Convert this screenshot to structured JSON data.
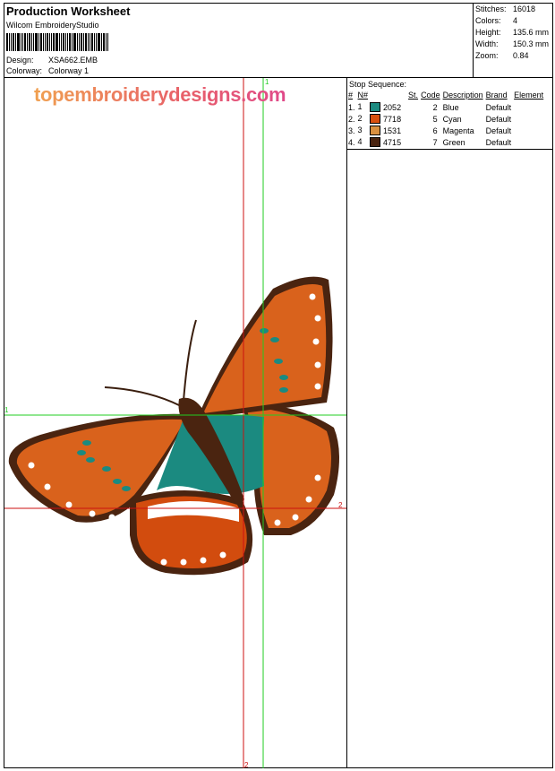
{
  "header": {
    "title": "Production Worksheet",
    "software": "Wilcom EmbroideryStudio",
    "design_label": "Design:",
    "design_value": "XSA662.EMB",
    "colorway_label": "Colorway:",
    "colorway_value": "Colorway 1"
  },
  "stats": [
    {
      "label": "Stitches:",
      "value": "16018"
    },
    {
      "label": "Colors:",
      "value": "4"
    },
    {
      "label": "Height:",
      "value": "135.6 mm"
    },
    {
      "label": "Width:",
      "value": "150.3 mm"
    },
    {
      "label": "Zoom:",
      "value": "0.84"
    }
  ],
  "sequence": {
    "title": "Stop Sequence:",
    "headers": [
      "#",
      "N#",
      "St.",
      "Code",
      "Description",
      "Brand",
      "Element"
    ],
    "rows": [
      {
        "num": "1.",
        "n": "1",
        "color": "#1b8a80",
        "st": "2052",
        "code": "2",
        "desc": "Blue",
        "brand": "Default"
      },
      {
        "num": "2.",
        "n": "2",
        "color": "#d9500f",
        "st": "7718",
        "code": "5",
        "desc": "Cyan",
        "brand": "Default"
      },
      {
        "num": "3.",
        "n": "3",
        "color": "#d99040",
        "st": "1531",
        "code": "6",
        "desc": "Magenta",
        "brand": "Default"
      },
      {
        "num": "4.",
        "n": "4",
        "color": "#4a2410",
        "st": "4715",
        "code": "7",
        "desc": "Green",
        "brand": "Default"
      }
    ]
  },
  "watermark": "topembroiderydesigns.com",
  "guides": {
    "green_label": "1",
    "red_label": "2",
    "green_color": "#22cc22",
    "red_color": "#cc1111"
  }
}
